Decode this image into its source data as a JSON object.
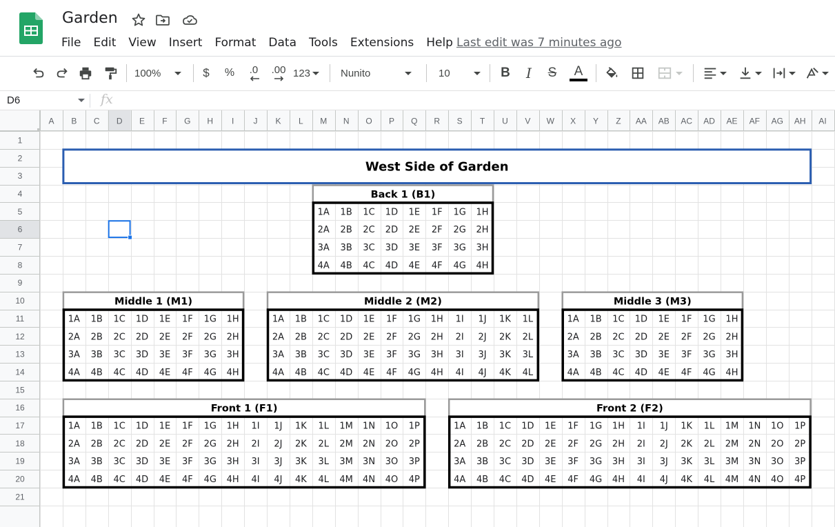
{
  "app": {
    "title": "Garden",
    "last_edit": "Last edit was 7 minutes ago",
    "icons": [
      "star-icon",
      "move-to-folder-icon",
      "cloud-status-icon"
    ]
  },
  "menu": [
    "File",
    "Edit",
    "View",
    "Insert",
    "Format",
    "Data",
    "Tools",
    "Extensions",
    "Help"
  ],
  "toolbar": {
    "zoom": "100%",
    "currency": "$",
    "percent": "%",
    "decrease_decimal": ".0",
    "increase_decimal": ".00",
    "more_formats": "123",
    "font": "Nunito",
    "font_size": "10",
    "bold": "B",
    "italic": "I",
    "strikethrough": "S",
    "text_color": "A",
    "text_color_value": "#000000"
  },
  "formula_bar": {
    "name_box": "D6",
    "fx": "fx",
    "value": ""
  },
  "sheet": {
    "columns": [
      "A",
      "B",
      "C",
      "D",
      "E",
      "F",
      "G",
      "H",
      "I",
      "J",
      "K",
      "L",
      "M",
      "N",
      "O",
      "P",
      "Q",
      "R",
      "S",
      "T",
      "U",
      "V",
      "W",
      "X",
      "Y",
      "Z",
      "AA",
      "AB",
      "AC",
      "AD",
      "AE",
      "AF",
      "AG",
      "AH",
      "AI"
    ],
    "rows": [
      "1",
      "2",
      "3",
      "4",
      "5",
      "6",
      "7",
      "8",
      "9",
      "10",
      "11",
      "12",
      "13",
      "14",
      "15",
      "16",
      "17",
      "18",
      "19",
      "20",
      "21"
    ],
    "selected_cell": "D6",
    "selection_color": "#1a73e8",
    "title": "West Side of Garden",
    "title_border_color": "#2a5db0",
    "blocks": [
      {
        "title": "Back 1 (B1)",
        "cells": [
          [
            "1A",
            "1B",
            "1C",
            "1D",
            "1E",
            "1F",
            "1G",
            "1H"
          ],
          [
            "2A",
            "2B",
            "2C",
            "2D",
            "2E",
            "2F",
            "2G",
            "2H"
          ],
          [
            "3A",
            "3B",
            "3C",
            "3D",
            "3E",
            "3F",
            "3G",
            "3H"
          ],
          [
            "4A",
            "4B",
            "4C",
            "4D",
            "4E",
            "4F",
            "4G",
            "4H"
          ]
        ]
      },
      {
        "title": "Middle 1 (M1)",
        "cells": [
          [
            "1A",
            "1B",
            "1C",
            "1D",
            "1E",
            "1F",
            "1G",
            "1H"
          ],
          [
            "2A",
            "2B",
            "2C",
            "2D",
            "2E",
            "2F",
            "2G",
            "2H"
          ],
          [
            "3A",
            "3B",
            "3C",
            "3D",
            "3E",
            "3F",
            "3G",
            "3H"
          ],
          [
            "4A",
            "4B",
            "4C",
            "4D",
            "4E",
            "4F",
            "4G",
            "4H"
          ]
        ]
      },
      {
        "title": "Middle 2 (M2)",
        "cells": [
          [
            "1A",
            "1B",
            "1C",
            "1D",
            "1E",
            "1F",
            "1G",
            "1H",
            "1I",
            "1J",
            "1K",
            "1L"
          ],
          [
            "2A",
            "2B",
            "2C",
            "2D",
            "2E",
            "2F",
            "2G",
            "2H",
            "2I",
            "2J",
            "2K",
            "2L"
          ],
          [
            "3A",
            "3B",
            "3C",
            "3D",
            "3E",
            "3F",
            "3G",
            "3H",
            "3I",
            "3J",
            "3K",
            "3L"
          ],
          [
            "4A",
            "4B",
            "4C",
            "4D",
            "4E",
            "4F",
            "4G",
            "4H",
            "4I",
            "4J",
            "4K",
            "4L"
          ]
        ]
      },
      {
        "title": "Middle 3 (M3)",
        "cells": [
          [
            "1A",
            "1B",
            "1C",
            "1D",
            "1E",
            "1F",
            "1G",
            "1H"
          ],
          [
            "2A",
            "2B",
            "2C",
            "2D",
            "2E",
            "2F",
            "2G",
            "2H"
          ],
          [
            "3A",
            "3B",
            "3C",
            "3D",
            "3E",
            "3F",
            "3G",
            "3H"
          ],
          [
            "4A",
            "4B",
            "4C",
            "4D",
            "4E",
            "4F",
            "4G",
            "4H"
          ]
        ]
      },
      {
        "title": "Front 1 (F1)",
        "cells": [
          [
            "1A",
            "1B",
            "1C",
            "1D",
            "1E",
            "1F",
            "1G",
            "1H",
            "1I",
            "1J",
            "1K",
            "1L",
            "1M",
            "1N",
            "1O",
            "1P"
          ],
          [
            "2A",
            "2B",
            "2C",
            "2D",
            "2E",
            "2F",
            "2G",
            "2H",
            "2I",
            "2J",
            "2K",
            "2L",
            "2M",
            "2N",
            "2O",
            "2P"
          ],
          [
            "3A",
            "3B",
            "3C",
            "3D",
            "3E",
            "3F",
            "3G",
            "3H",
            "3I",
            "3J",
            "3K",
            "3L",
            "3M",
            "3N",
            "3O",
            "3P"
          ],
          [
            "4A",
            "4B",
            "4C",
            "4D",
            "4E",
            "4F",
            "4G",
            "4H",
            "4I",
            "4J",
            "4K",
            "4L",
            "4M",
            "4N",
            "4O",
            "4P"
          ]
        ]
      },
      {
        "title": "Front 2 (F2)",
        "cells": [
          [
            "1A",
            "1B",
            "1C",
            "1D",
            "1E",
            "1F",
            "1G",
            "1H",
            "1I",
            "1J",
            "1K",
            "1L",
            "1M",
            "1N",
            "1O",
            "1P"
          ],
          [
            "2A",
            "2B",
            "2C",
            "2D",
            "2E",
            "2F",
            "2G",
            "2H",
            "2I",
            "2J",
            "2K",
            "2L",
            "2M",
            "2N",
            "2O",
            "2P"
          ],
          [
            "3A",
            "3B",
            "3C",
            "3D",
            "3E",
            "3F",
            "3G",
            "3H",
            "3I",
            "3J",
            "3K",
            "3L",
            "3M",
            "3N",
            "3O",
            "3P"
          ],
          [
            "4A",
            "4B",
            "4C",
            "4D",
            "4E",
            "4F",
            "4G",
            "4H",
            "4I",
            "4J",
            "4K",
            "4L",
            "4M",
            "4N",
            "4O",
            "4P"
          ]
        ]
      }
    ]
  }
}
